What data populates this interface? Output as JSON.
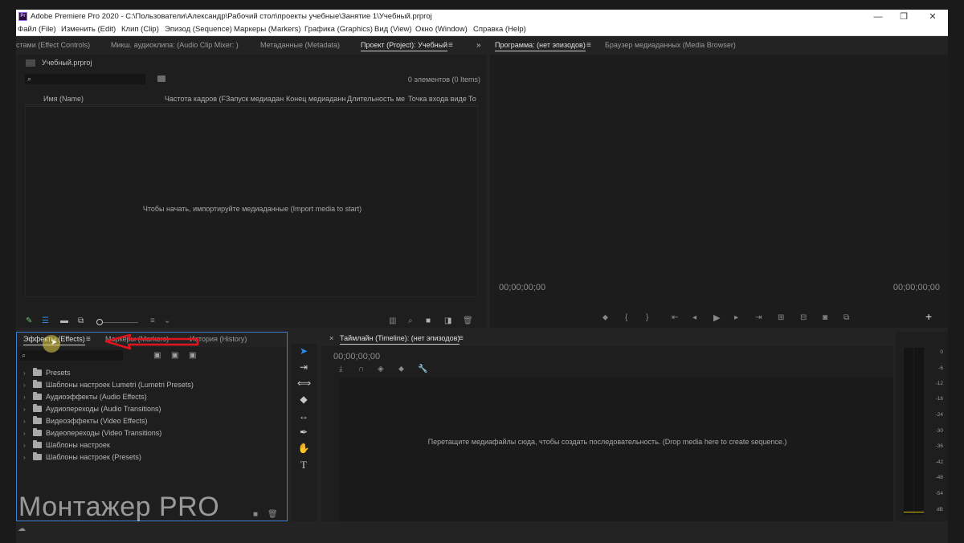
{
  "window": {
    "title": "Adobe Premiere Pro 2020 - C:\\Пользователи\\Александр\\Рабочий стол\\проекты учебные\\Занятие 1\\Учебный.prproj",
    "app_icon": "Pr",
    "minimize": "—",
    "restore": "❐",
    "close": "✕"
  },
  "menu": [
    "Файл (File)",
    "Изменить (Edit)",
    "Клип (Clip)",
    "Эпизод (Sequence)",
    "Маркеры (Markers)",
    "Графика (Graphics)",
    "Вид (View)",
    "Окно (Window)",
    "Справка (Help)"
  ],
  "top_left_tabs": [
    "стами (Effect Controls)",
    "Микш. аудиоклипа: (Audio Clip Mixer: )",
    "Метаданные (Metadata)",
    "Проект (Project): Учебный"
  ],
  "top_right_tabs": [
    "Программа: (нет эпизодов)",
    "Браузер медиаданных (Media Browser)"
  ],
  "overflow_glyph": "»",
  "menu_glyph": "≡",
  "project": {
    "file_name": "Учебный.prproj",
    "search_placeholder": "",
    "item_count": "0 элементов (0 Items)",
    "columns": [
      "Имя (Name)",
      "Частота кадров (F",
      "Запуск медиадан",
      "Конец медиаданн",
      "Длительность ме",
      "Точка входа виде",
      "То"
    ],
    "empty_message": "Чтобы начать, импортируйте медиаданные (Import media to start)"
  },
  "program": {
    "timecode_left": "00;00;00;00",
    "timecode_right": "00;00;00;00",
    "add_button": "+"
  },
  "effects": {
    "tabs": [
      "Эффекты (Effects)",
      "Маркеры (Markers)",
      "История (History)"
    ],
    "items": [
      "Presets",
      "Шаблоны настроек Lumetri (Lumetri Presets)",
      "Аудиоэффекты (Audio Effects)",
      "Аудиопереходы (Audio Transitions)",
      "Видеоэффекты (Video Effects)",
      "Видеопереходы (Video Transitions)",
      "Шаблоны настроек",
      "Шаблоны настроек (Presets)"
    ]
  },
  "timeline": {
    "close": "×",
    "tab": "Таймлайн (Timeline): (нет эпизодов)",
    "timecode": "00;00;00;00",
    "drop_message": "Перетащите медиафайлы сюда, чтобы создать последовательность. (Drop media here to create sequence.)"
  },
  "vu_scale": [
    "0",
    "-6",
    "-12",
    "-18",
    "-24",
    "-30",
    "-36",
    "-42",
    "-48",
    "-54",
    "dB"
  ],
  "watermark": "Монтажер PRO",
  "colors": {
    "accent_blue": "#2d8ceb",
    "annotation_red": "#e0141e",
    "watermark": "#ffffff"
  }
}
